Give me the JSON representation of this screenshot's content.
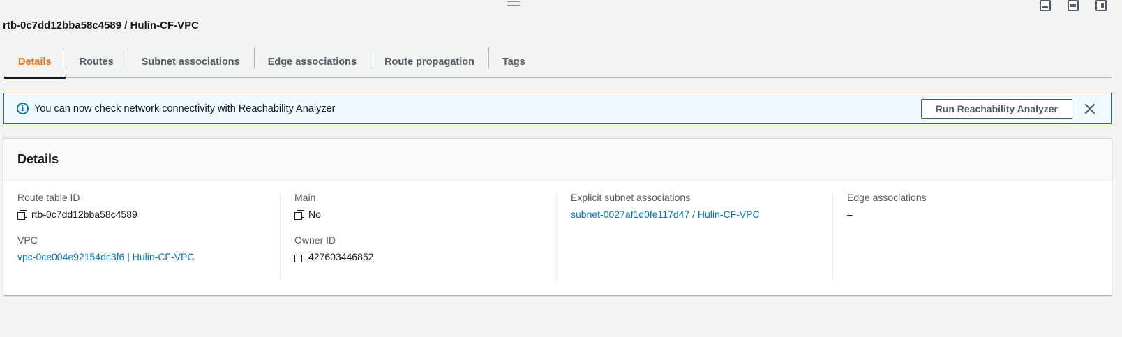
{
  "title": "rtb-0c7dd12bba58c4589 / Hulin-CF-VPC",
  "tabs": [
    {
      "label": "Details"
    },
    {
      "label": "Routes"
    },
    {
      "label": "Subnet associations"
    },
    {
      "label": "Edge associations"
    },
    {
      "label": "Route propagation"
    },
    {
      "label": "Tags"
    }
  ],
  "banner": {
    "text": "You can now check network connectivity with Reachability Analyzer",
    "button_label": "Run Reachability Analyzer",
    "icon": "info-icon"
  },
  "details": {
    "heading": "Details",
    "route_table_id": {
      "label": "Route table ID",
      "value": "rtb-0c7dd12bba58c4589"
    },
    "vpc": {
      "label": "VPC",
      "value": "vpc-0ce004e92154dc3f6 | Hulin-CF-VPC"
    },
    "main": {
      "label": "Main",
      "value": "No"
    },
    "owner_id": {
      "label": "Owner ID",
      "value": "427603446852"
    },
    "explicit_subnet": {
      "label": "Explicit subnet associations",
      "value": "subnet-0027af1d0fe117d47 / Hulin-CF-VPC"
    },
    "edge": {
      "label": "Edge associations",
      "value": "–"
    }
  },
  "colors": {
    "active_tab": "#ec7211",
    "link": "#0073bb",
    "banner_bg": "#f1faff",
    "banner_border": "#0073bb"
  }
}
